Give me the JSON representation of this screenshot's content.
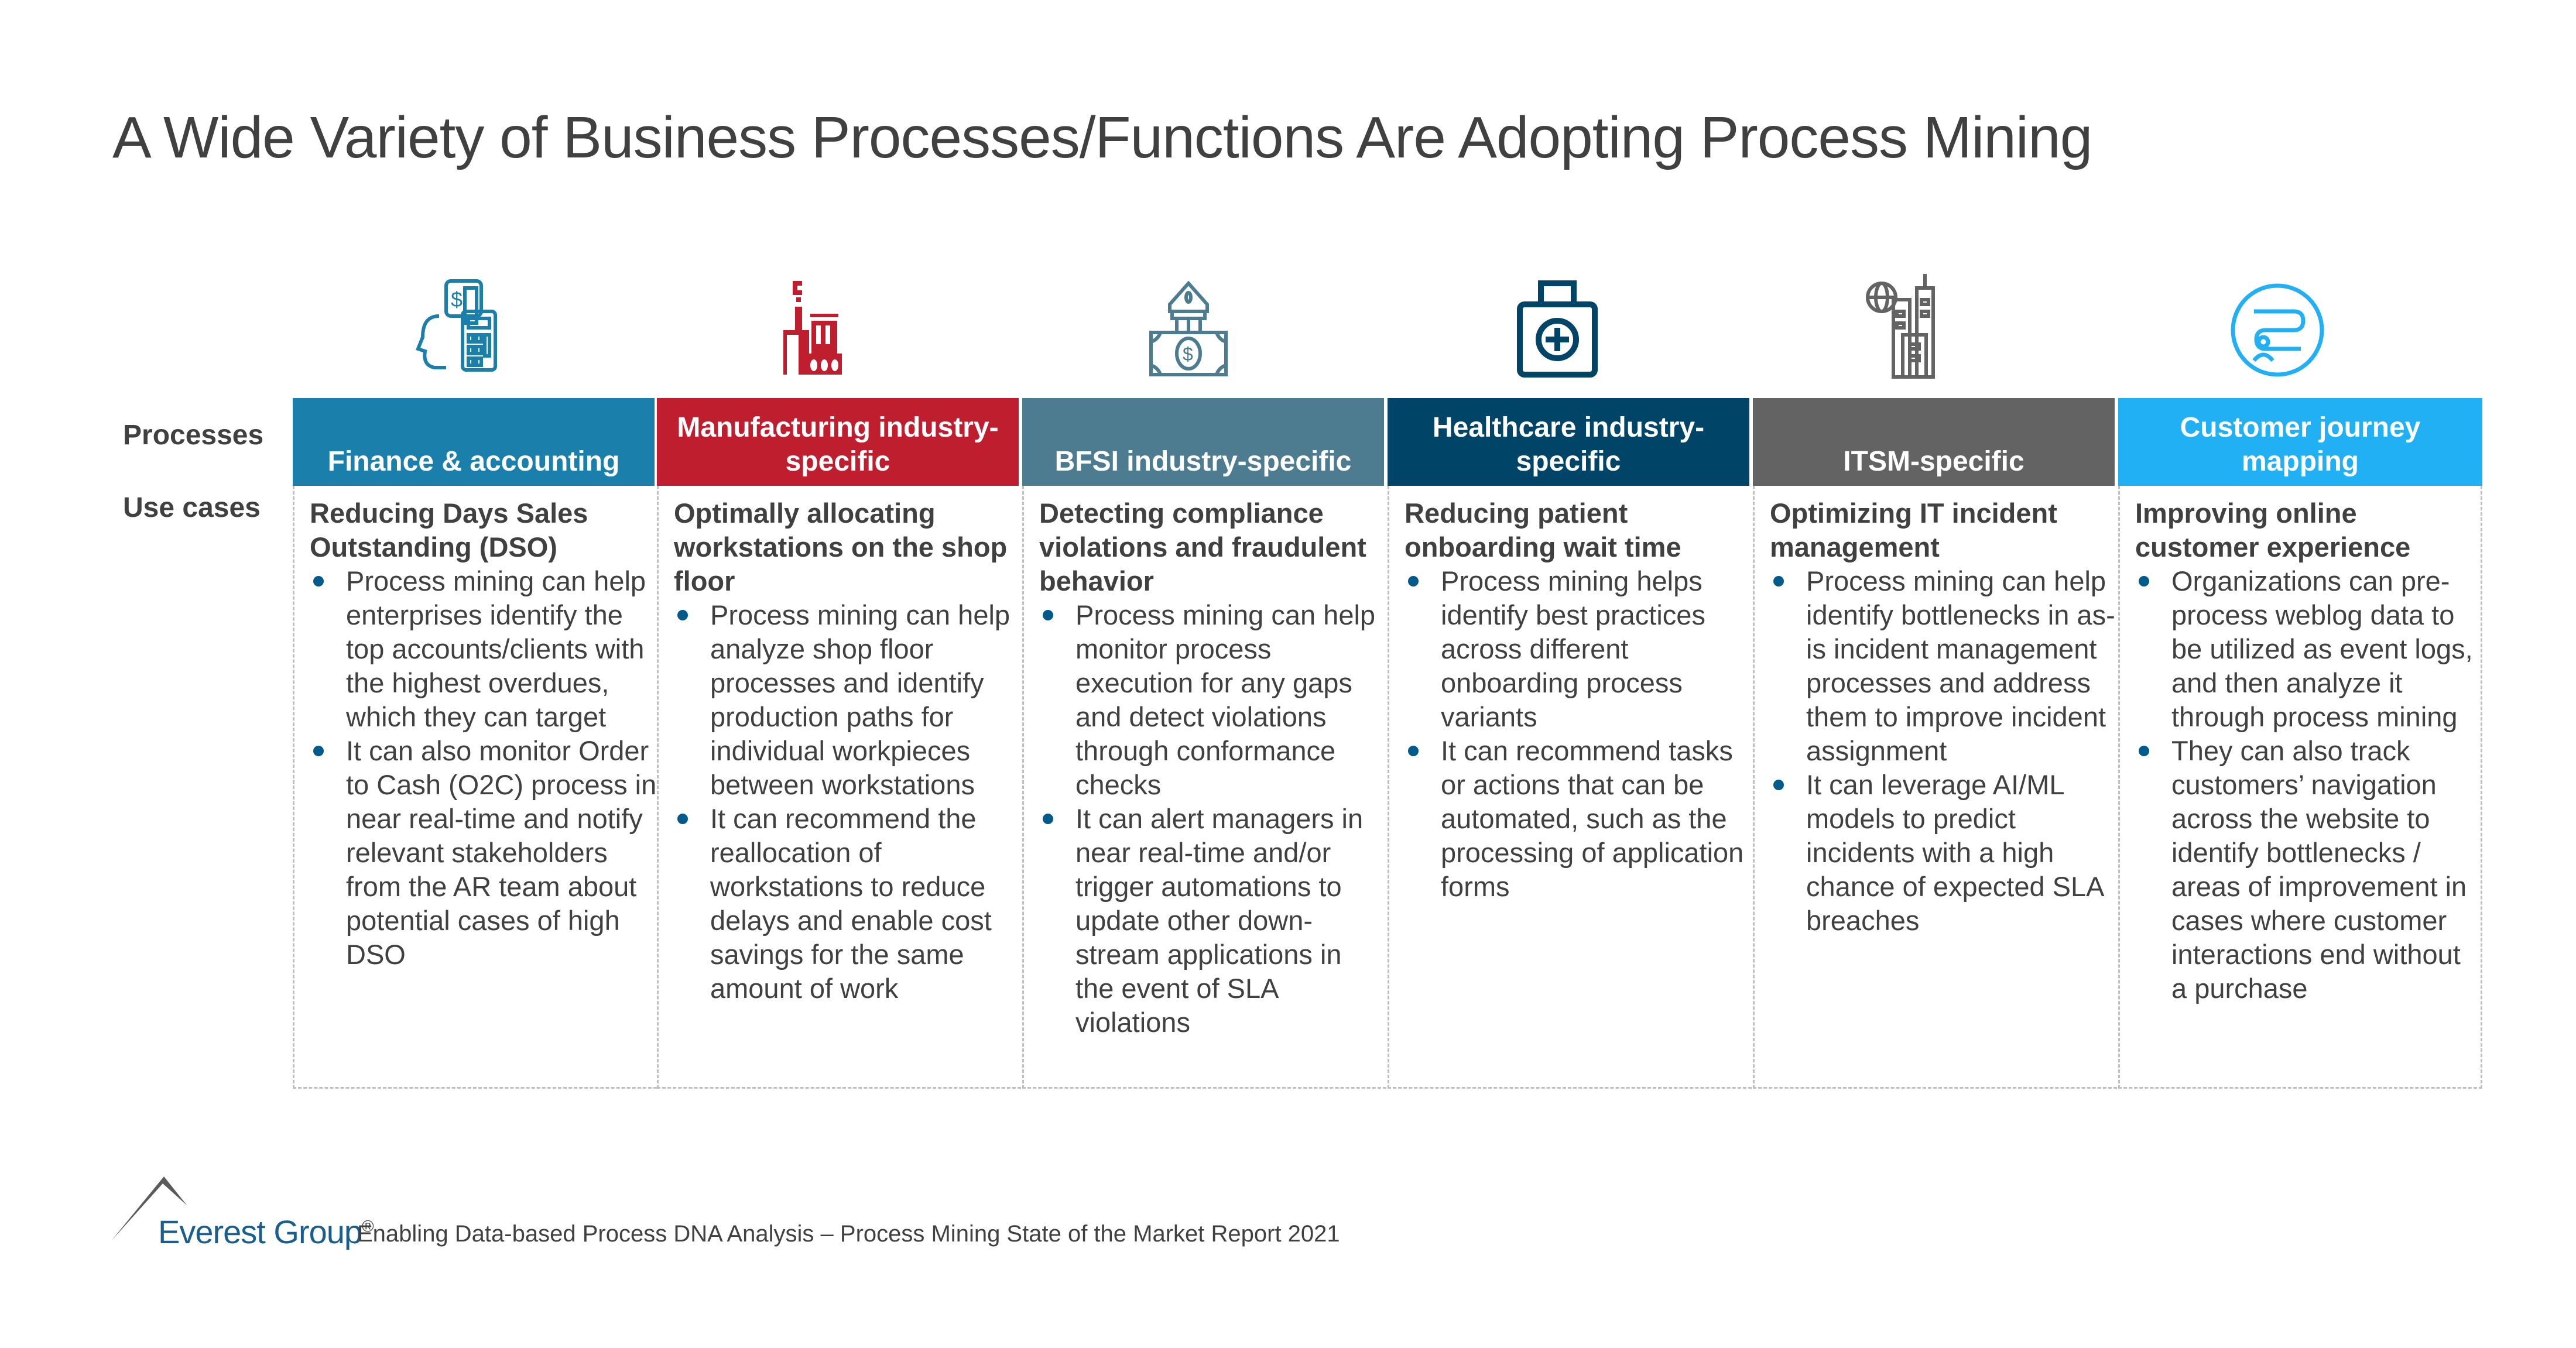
{
  "title": "A Wide Variety of Business Processes/Functions Are Adopting Process Mining",
  "row_labels": {
    "processes": "Processes",
    "use_cases": "Use cases"
  },
  "columns": [
    {
      "process": "Finance & accounting",
      "color": "#1b7fab",
      "icon": "finance-accounting-icon",
      "use_case_title": "Reducing Days Sales Outstanding (DSO)",
      "bullets": [
        "Process mining can help enterprises identify the top accounts/clients with the highest overdues, which they can target",
        "It can also monitor Order to Cash (O2C) process in near real-time and notify relevant stakeholders from the AR team about potential cases of high DSO"
      ]
    },
    {
      "process": "Manufacturing industry-specific",
      "color": "#bf1e2e",
      "icon": "factory-icon",
      "use_case_title": "Optimally allocating workstations on the shop floor",
      "bullets": [
        "Process mining can help analyze shop floor processes and identify production paths for individual workpieces between workstations",
        "It can recommend the reallocation of workstations to reduce delays and enable cost savings for the same amount of work"
      ]
    },
    {
      "process": "BFSI industry-specific",
      "color": "#4d7b8f",
      "icon": "bank-icon",
      "use_case_title": "Detecting compliance violations and fraudulent behavior",
      "bullets": [
        "Process mining can help monitor process execution for any gaps and detect violations through conformance checks",
        "It can alert managers in near real-time and/or trigger automations to update other down-stream applications in the event of SLA violations"
      ]
    },
    {
      "process": "Healthcare industry- specific",
      "color": "#004468",
      "icon": "medical-kit-icon",
      "use_case_title": "Reducing patient onboarding wait time",
      "bullets": [
        "Process mining helps identify best practices across different onboarding process variants",
        "It can recommend tasks or actions that can be automated, such as the processing of application forms"
      ]
    },
    {
      "process": "ITSM-specific",
      "color": "#636363",
      "icon": "buildings-globe-icon",
      "use_case_title": "Optimizing IT incident management",
      "bullets": [
        "Process mining can help identify bottlenecks in as-is incident management processes and address them to improve incident assignment",
        "It can leverage AI/ML models to predict incidents with a high chance of expected SLA breaches"
      ]
    },
    {
      "process": "Customer journey mapping",
      "color": "#22b0f5",
      "icon": "customer-journey-icon",
      "use_case_title": "Improving online customer experience",
      "bullets": [
        "Organizations can pre-process weblog data to be utilized as event logs, and then analyze it through process mining",
        "They can also track customers’ navigation across the website to identify bottlenecks / areas of improvement in cases where customer interactions end without a purchase"
      ]
    }
  ],
  "footer": {
    "logo": "Everest Group",
    "registered": "®",
    "source": "Enabling Data-based Process DNA Analysis – Process Mining State of the Market Report 2021"
  }
}
